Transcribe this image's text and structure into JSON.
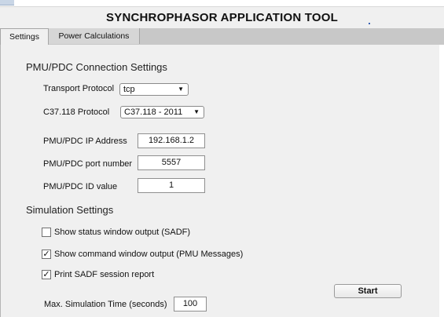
{
  "app": {
    "title": "SYNCHROPHASOR APPLICATION TOOL"
  },
  "tabs": [
    {
      "label": "Settings",
      "active": true
    },
    {
      "label": "Power Calculations",
      "active": false
    }
  ],
  "pmu": {
    "section_title": "PMU/PDC Connection Settings",
    "transport_label": "Transport Protocol",
    "transport_value": "tcp",
    "c37_label": "C37.118 Protocol",
    "c37_value": "C37.118 - 2011",
    "ip_label": "PMU/PDC IP Address",
    "ip_value": "192.168.1.2",
    "port_label": "PMU/PDC port number",
    "port_value": "5557",
    "id_label": "PMU/PDC ID value",
    "id_value": "1"
  },
  "sim": {
    "section_title": "Simulation Settings",
    "options": [
      {
        "label": "Show status window output (SADF)",
        "checked": false
      },
      {
        "label": "Show command window output (PMU Messages)",
        "checked": true
      },
      {
        "label": "Print SADF session report",
        "checked": true
      }
    ],
    "max_time_label": "Max. Simulation Time (seconds)",
    "max_time_value": "100",
    "start_label": "Start"
  },
  "colors": {
    "panel_bg": "#f0f0f0",
    "tabbar_bg": "#c8c8c8",
    "title_dot": "#3a63b5"
  },
  "icons": {
    "dropdown": "triangle-down",
    "check": "checkmark"
  }
}
